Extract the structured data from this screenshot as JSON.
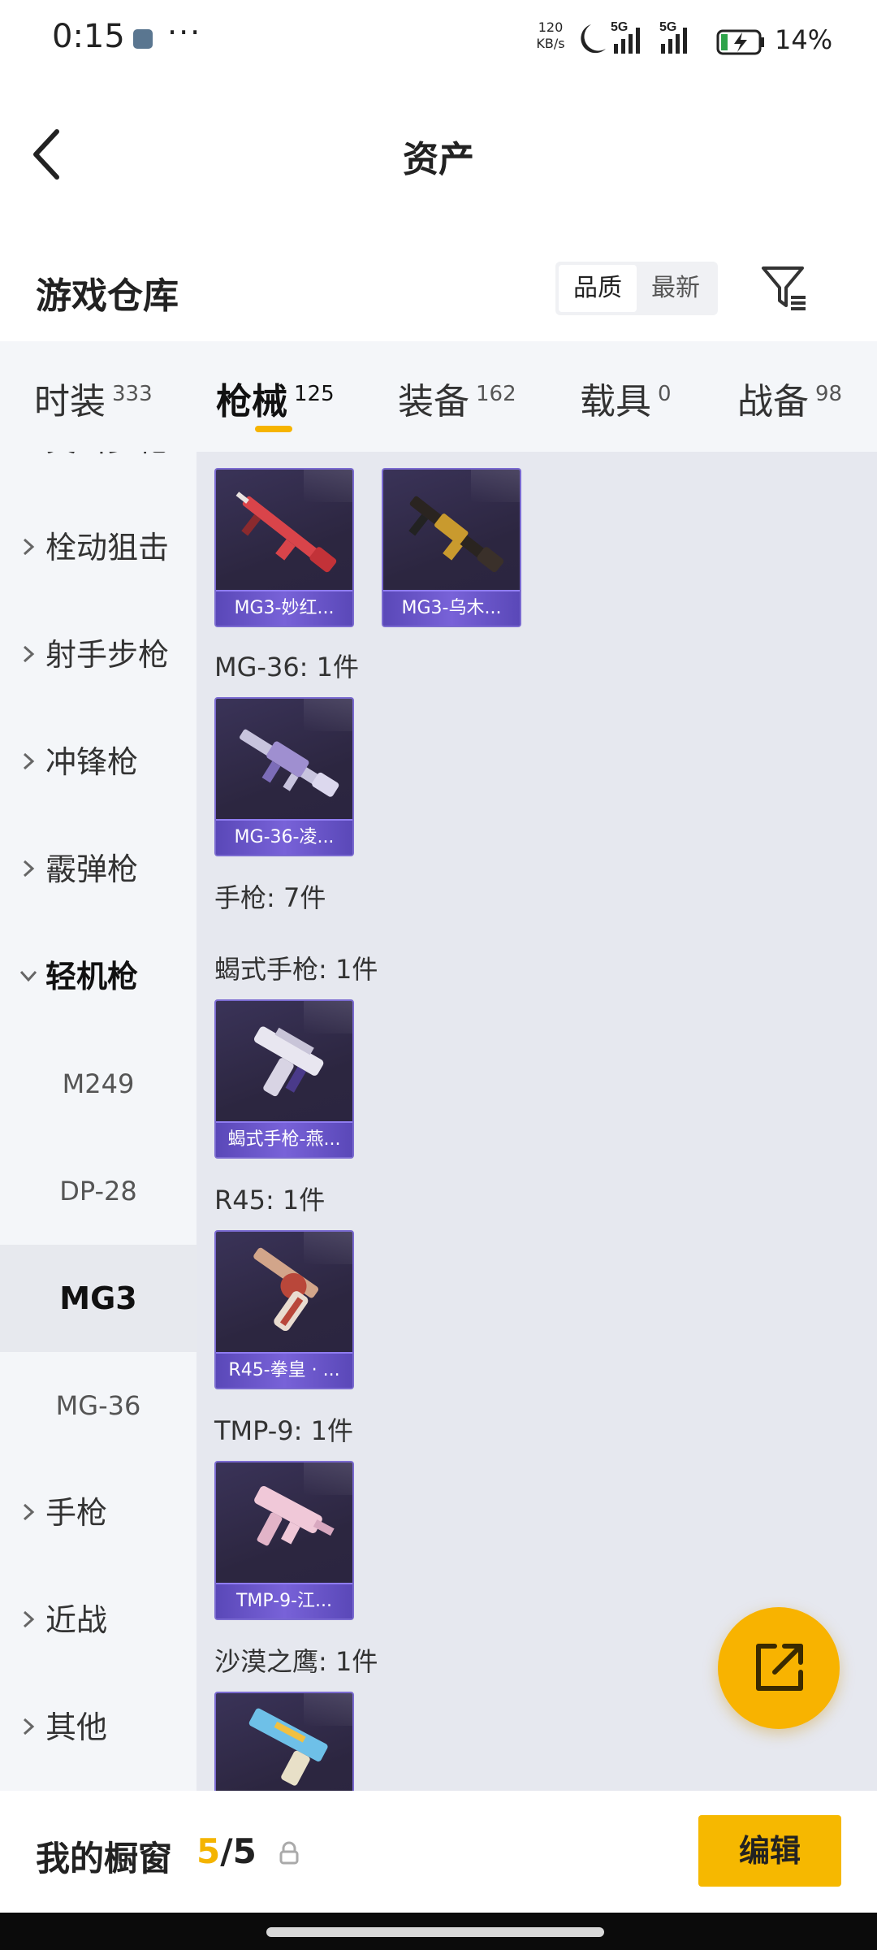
{
  "status_bar": {
    "time": "0:15",
    "dots": "···",
    "speed_value": "120",
    "speed_unit": "KB/s",
    "network1": "5G",
    "network2": "5G",
    "battery": "14%"
  },
  "header": {
    "title": "资产"
  },
  "section": {
    "title": "游戏仓库",
    "sort_options": [
      "品质",
      "最新"
    ]
  },
  "tabs": [
    {
      "label": "时装",
      "count": "333"
    },
    {
      "label": "枪械",
      "count": "125"
    },
    {
      "label": "装备",
      "count": "162"
    },
    {
      "label": "载具",
      "count": "0"
    },
    {
      "label": "战备",
      "count": "98"
    }
  ],
  "sidebar": [
    {
      "label": "突击步枪"
    },
    {
      "label": "栓动狙击"
    },
    {
      "label": "射手步枪"
    },
    {
      "label": "冲锋枪"
    },
    {
      "label": "霰弹枪"
    },
    {
      "label": "轻机枪"
    },
    {
      "label": "M249"
    },
    {
      "label": "DP-28"
    },
    {
      "label": "MG3"
    },
    {
      "label": "MG-36"
    },
    {
      "label": "手枪"
    },
    {
      "label": "近战"
    },
    {
      "label": "其他"
    }
  ],
  "content": {
    "mg3_items": [
      {
        "label": "MG3-妙红..."
      },
      {
        "label": "MG3-乌木..."
      }
    ],
    "mg36_group": "MG-36: 1件",
    "mg36_items": [
      {
        "label": "MG-36-凌..."
      }
    ],
    "pistol_group": "手枪: 7件",
    "scorpion_group": "蝎式手枪: 1件",
    "scorpion_items": [
      {
        "label": "蝎式手枪-燕..."
      }
    ],
    "r45_group": "R45: 1件",
    "r45_items": [
      {
        "label": "R45-拳皇 · ..."
      }
    ],
    "tmp9_group": "TMP-9: 1件",
    "tmp9_items": [
      {
        "label": "TMP-9-江..."
      }
    ],
    "deagle_group": "沙漠之鹰: 1件"
  },
  "bottom_bar": {
    "showcase_label": "我的橱窗",
    "showcase_current": "5",
    "showcase_separator": "/",
    "showcase_total": "5",
    "edit_label": "编辑"
  },
  "colors": {
    "accent": "#f6b800",
    "card_label_bg": "#6a55c8"
  }
}
